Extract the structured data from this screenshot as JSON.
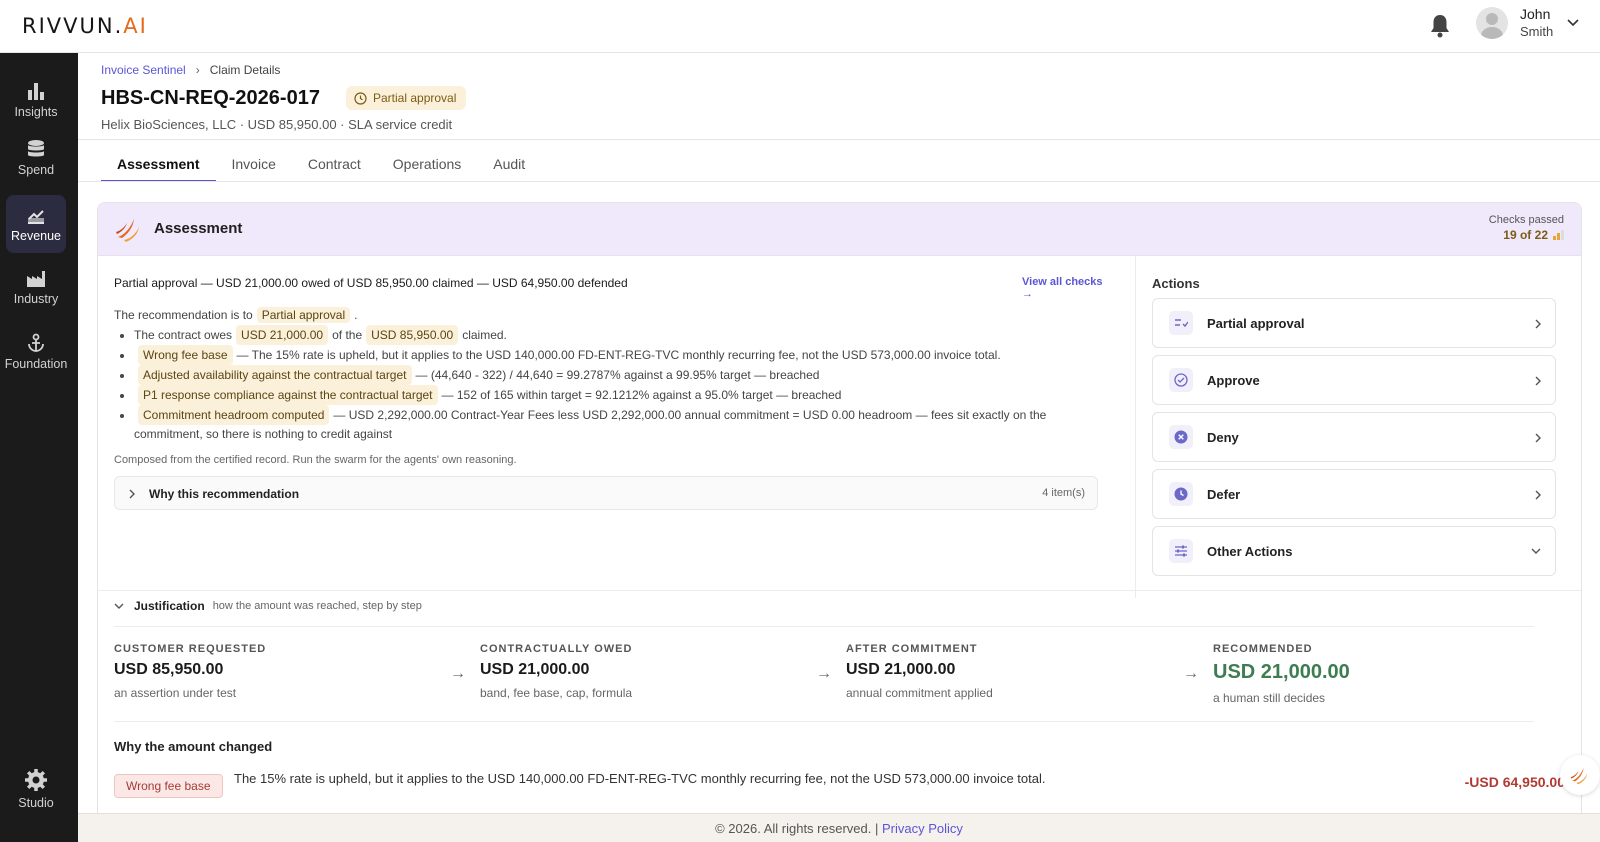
{
  "header": {
    "logo_main": "RIVVUN.",
    "logo_suffix": "AI",
    "user_first": "John",
    "user_last": "Smith"
  },
  "sidebar": {
    "items": [
      {
        "label": "Insights",
        "icon": "bar-chart-icon"
      },
      {
        "label": "Spend",
        "icon": "database-icon"
      },
      {
        "label": "Revenue",
        "icon": "revenue-icon",
        "active": true
      },
      {
        "label": "Industry",
        "icon": "factory-icon"
      },
      {
        "label": "Foundation",
        "icon": "anchor-icon"
      }
    ],
    "studio": "Studio"
  },
  "breadcrumb": {
    "parent": "Invoice Sentinel",
    "current": "Claim Details"
  },
  "claim": {
    "id": "HBS-CN-REQ-2026-017",
    "status": "Partial approval",
    "subtitle": "Helix BioSciences, LLC · USD 85,950.00 · SLA service credit"
  },
  "tabs": [
    "Assessment",
    "Invoice",
    "Contract",
    "Operations",
    "Audit"
  ],
  "assessment": {
    "title": "Assessment",
    "checks_label": "Checks passed",
    "checks_value": "19 of 22",
    "summary": "Partial approval — USD 21,000.00 owed of USD 85,950.00 claimed — USD 64,950.00 defended",
    "view_all": "View all checks →",
    "rec_prefix": "The recommendation is to",
    "rec_tag": "Partial approval",
    "rec_suffix": ".",
    "b1_pre": "The contract owes",
    "b1_tag1": "USD 21,000.00",
    "b1_mid": "of the",
    "b1_tag2": "USD 85,950.00",
    "b1_post": "claimed.",
    "b2_tag": "Wrong fee base",
    "b2_text": "— The 15% rate is upheld, but it applies to the USD 140,000.00 FD-ENT-REG-TVC monthly recurring fee, not the USD 573,000.00 invoice total.",
    "b3_tag": "Adjusted availability against the contractual target",
    "b3_text": "— (44,640 - 322) / 44,640 = 99.2787% against a 99.95% target — breached",
    "b4_tag": "P1 response compliance against the contractual target",
    "b4_text": "— 152 of 165 within target = 92.1212% against a 95.0% target — breached",
    "b5_tag": "Commitment headroom computed",
    "b5_text": "— USD 2,292,000.00 Contract-Year Fees less USD 2,292,000.00 annual commitment = USD 0.00 headroom — fees sit exactly on the commitment, so there is nothing to credit against",
    "composed": "Composed from the certified record. Run the swarm for the agents' own reasoning.",
    "why_label": "Why this recommendation",
    "why_count": "4 item(s)"
  },
  "actions": {
    "title": "Actions",
    "items": [
      {
        "label": "Partial approval",
        "icon": "partial-approval-icon"
      },
      {
        "label": "Approve",
        "icon": "check-circle-icon"
      },
      {
        "label": "Deny",
        "icon": "x-circle-icon"
      },
      {
        "label": "Defer",
        "icon": "clock-icon"
      },
      {
        "label": "Other Actions",
        "icon": "sliders-icon"
      }
    ]
  },
  "justification": {
    "label": "Justification",
    "desc": "how the amount was reached, step by step",
    "steps": [
      {
        "label": "CUSTOMER REQUESTED",
        "value": "USD 85,950.00",
        "sub": "an assertion under test"
      },
      {
        "label": "CONTRACTUALLY OWED",
        "value": "USD 21,000.00",
        "sub": "band, fee base, cap, formula"
      },
      {
        "label": "AFTER COMMITMENT",
        "value": "USD 21,000.00",
        "sub": "annual commitment applied"
      },
      {
        "label": "RECOMMENDED",
        "value": "USD 21,000.00",
        "sub": "a human still decides"
      }
    ],
    "arrow": "→",
    "why_changed": "Why the amount changed",
    "change_tag": "Wrong fee base",
    "change_text": "The 15% rate is upheld, but it applies to the USD 140,000.00 FD-ENT-REG-TVC monthly recurring fee, not the USD 573,000.00 invoice total.",
    "change_amount": "-USD 64,950.00"
  },
  "footer": {
    "copyright": "© 2026. All rights reserved. |",
    "privacy": "Privacy Policy"
  },
  "colors": {
    "accent": "#5b56d6",
    "sidebar": "#1b1b1c",
    "badge_bg": "#fbf0d9",
    "green": "#3d7d50",
    "red": "#b23a32"
  }
}
